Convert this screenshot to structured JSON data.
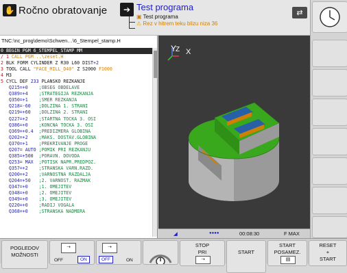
{
  "header": {
    "mode_left": "Ročno obratovanje",
    "mode_right_title": "Test programa",
    "sub_title": "Test programa",
    "warning": "Rez v hitrem teku blizu niza 36"
  },
  "program": {
    "path": "TNC:\\nc_prog\\demo\\Schwen…\\6_Stempel_stamp.H",
    "lines": [
      {
        "n": "0",
        "text": "BEGIN PGM 6_STEMPEL_STAMP MM",
        "sel": true
      },
      {
        "n": "/ 1",
        "text": "CALL PGM ..\\zeset.H"
      },
      {
        "n": "2",
        "text": "BLK FORM CYLINDER Z R30 L60 DIST+2"
      },
      {
        "n": "3",
        "text": "TOOL CALL \"FACE_MILL_D40\" Z S2000 F1000"
      },
      {
        "n": "4",
        "text": "M3"
      },
      {
        "n": "5",
        "text": "CYCL DEF 233 PLANSKO REZKANJE"
      },
      {
        "p": "Q215=+0",
        "c": ";OBSEG OBDELAVE"
      },
      {
        "p": "Q389=+4",
        "c": ";STRATEGIJA REZKANJA"
      },
      {
        "p": "Q350=+1",
        "c": ";SMER REZKANJA"
      },
      {
        "p": "Q218=-60",
        "c": ";DOLZINA 1. STRANI"
      },
      {
        "p": "Q219=+60",
        "c": ";DOLZINA 2. STRANI"
      },
      {
        "p": "Q227=+2",
        "c": ";STARTNA TOCKA 3. OSI"
      },
      {
        "p": "Q386=+0",
        "c": ";KONCNA TOCKA 3. OSI"
      },
      {
        "p": "Q369=+0.4",
        "c": ";PREDIZMERA GLOBINA"
      },
      {
        "p": "Q202=+2",
        "c": ";MAKS. DOSTAV.GLOBINA"
      },
      {
        "p": "Q370=+1",
        "c": ";PREKRIVANJE PROGE"
      },
      {
        "p": "Q207= AUTO",
        "c": ";POMIK PRI REZKANJU"
      },
      {
        "p": "Q385=+500",
        "c": ";PORAVN. DOVODA"
      },
      {
        "p": "Q253= MAX",
        "c": ";POTISK NAPR.PREDPOZ."
      },
      {
        "p": "Q357=+2",
        "c": ";STRANSKA VARN.RAZD."
      },
      {
        "p": "Q200=+2",
        "c": ";VARNOSTNA RAZDALJA"
      },
      {
        "p": "Q204=+50",
        "c": ";2. VARNOST. RAZMAK"
      },
      {
        "p": "Q347=+0",
        "c": ";1. OMEJITEV"
      },
      {
        "p": "Q348=+0",
        "c": ";2. OMEJITEV"
      },
      {
        "p": "Q349=+0",
        "c": ";3. OMEJITEV"
      },
      {
        "p": "Q220=+0",
        "c": ";RADIJ VOGALA"
      },
      {
        "p": "Q368=+0",
        "c": ";STRANSKA NADMERA"
      }
    ]
  },
  "graphic": {
    "axis_y": "Y",
    "axis_z": "Z",
    "axis_x": "X"
  },
  "status": {
    "time": "00:08:30",
    "feed": "F MAX"
  },
  "softkeys": {
    "pogledov_1": "POGLEDOV",
    "pogledov_2": "MOŽNOSTI",
    "off": "OFF",
    "on": "ON",
    "stop_1": "STOP",
    "stop_2": "PRI",
    "start": "START",
    "start_single_1": "START",
    "start_single_2": "POSAMEZ.",
    "reset_1": "RESET",
    "reset_2": "+",
    "reset_3": "START"
  },
  "colors": {
    "program_text": "#2020c0",
    "line_number": "#c41010",
    "comment": "#0a8a3a",
    "warning": "#d08000",
    "part_top": "#3aa81c",
    "part_side": "#9a9a9a",
    "part_blue": "#2860a8"
  }
}
